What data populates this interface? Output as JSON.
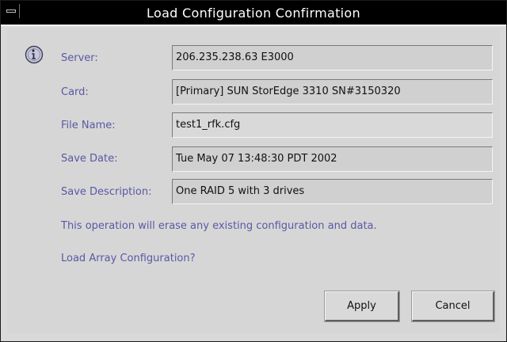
{
  "window": {
    "title": "Load Configuration Confirmation"
  },
  "icons": {
    "info": "info-icon",
    "window_menu": "window-menu-icon"
  },
  "colors": {
    "label_text": "#5a58a6",
    "titlebar": "#000000",
    "background": "#d6d6d6"
  },
  "form": {
    "server": {
      "label": "Server:",
      "value": "206.235.238.63 E3000"
    },
    "card": {
      "label": "Card:",
      "value": "[Primary] SUN StorEdge 3310 SN#3150320"
    },
    "file_name": {
      "label": "File Name:",
      "value": "test1_rfk.cfg"
    },
    "save_date": {
      "label": "Save Date:",
      "value": "Tue May 07 13:48:30 PDT 2002"
    },
    "save_description": {
      "label": "Save Description:",
      "value": "One RAID 5 with 3 drives"
    }
  },
  "messages": {
    "warning": "This operation will erase any existing configuration and data.",
    "question": "Load Array Configuration?"
  },
  "buttons": {
    "apply": "Apply",
    "cancel": "Cancel"
  }
}
